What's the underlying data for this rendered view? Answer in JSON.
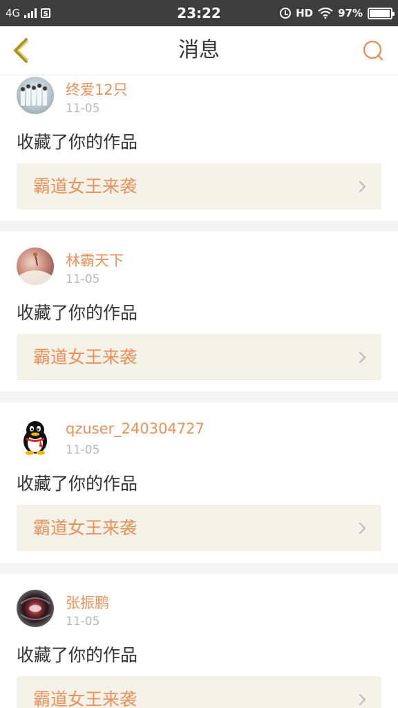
{
  "status_bar": {
    "network": "4G",
    "sim_icon": "S",
    "time": "23:22",
    "hd": "HD",
    "battery": "97%",
    "battery_level": 0.97
  },
  "header": {
    "title": "消息",
    "back_icon": "chevron-left-icon",
    "search_icon": "search-icon"
  },
  "colors": {
    "accent": "#e8915a",
    "work_bg": "#f3f1e8",
    "status_bg": "#3d3d3d"
  },
  "messages": [
    {
      "user": "终爱12只",
      "date": "11-05",
      "action": "收藏了你的作品",
      "work": "霸道女王来袭"
    },
    {
      "user": "林霸天下",
      "date": "11-05",
      "action": "收藏了你的作品",
      "work": "霸道女王来袭"
    },
    {
      "user": "qzuser_240304727",
      "date": "11-05",
      "action": "收藏了你的作品",
      "work": "霸道女王来袭"
    },
    {
      "user": "张振鹏",
      "date": "11-05",
      "action": "收藏了你的作品",
      "work": "霸道女王来袭"
    }
  ]
}
